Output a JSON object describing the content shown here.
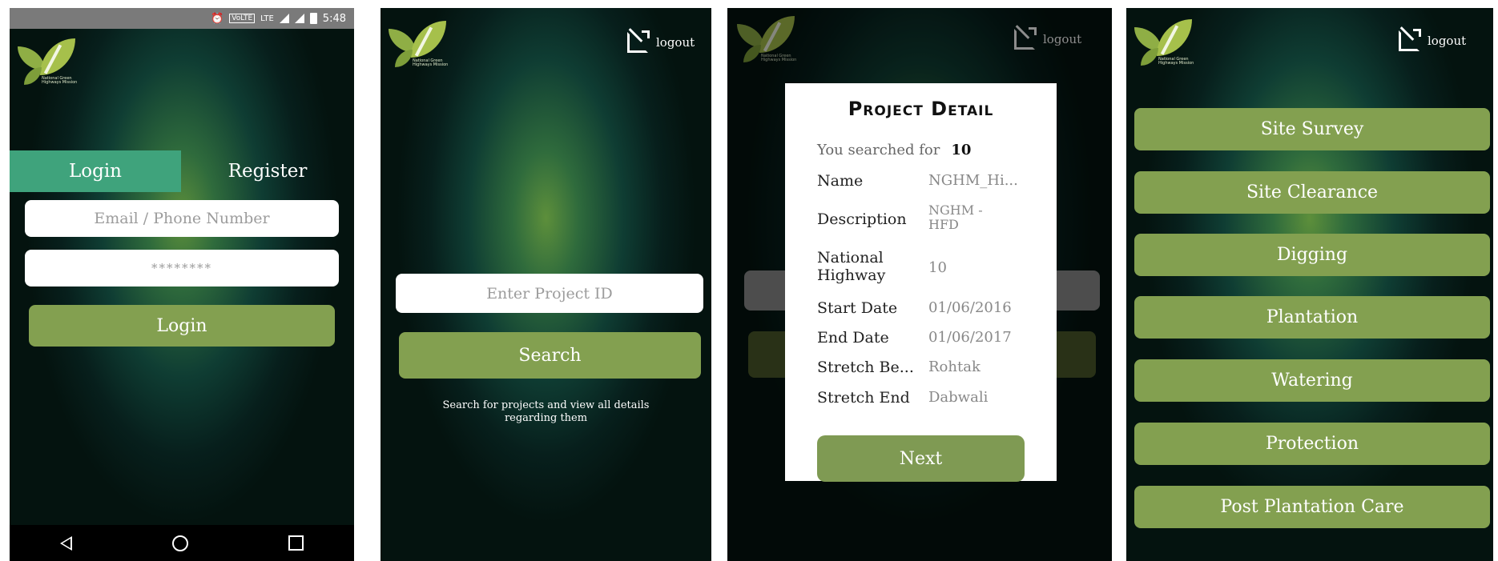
{
  "status_bar": {
    "icons": [
      "alarm-icon",
      "volte-icon",
      "lte-icon",
      "signal-icon",
      "signal-icon",
      "battery-icon"
    ],
    "volte": "VoLTE",
    "lte": "LTE",
    "time": "5:48"
  },
  "logo": {
    "tagline": "National Green Highways Mission"
  },
  "logout_label": "logout",
  "login_screen": {
    "tab_login": "Login",
    "tab_register": "Register",
    "email_placeholder": "Email / Phone Number",
    "password_value": "********",
    "login_button": "Login"
  },
  "search_screen": {
    "project_id_placeholder": "Enter Project ID",
    "search_button": "Search",
    "hint": "Search for projects and view all details regarding them"
  },
  "project_detail": {
    "title": "Project Detail",
    "searched_label": "You searched for",
    "searched_value": "10",
    "rows": [
      {
        "label": "Name",
        "value": "NGHM_Hi..."
      },
      {
        "label": "Description",
        "value": "NGHM - HFD"
      },
      {
        "label": "National Highway",
        "value": "10"
      },
      {
        "label": "Start Date",
        "value": "01/06/2016"
      },
      {
        "label": "End Date",
        "value": "01/06/2017"
      },
      {
        "label": "Stretch Be...",
        "value": "Rohtak"
      },
      {
        "label": "Stretch End",
        "value": "Dabwali"
      }
    ],
    "next_button": "Next"
  },
  "menu_screen": {
    "items": [
      "Site Survey",
      "Site Clearance",
      "Digging",
      "Plantation",
      "Watering",
      "Protection",
      "Post Plantation Care"
    ]
  },
  "colors": {
    "button_green": "#83a050",
    "tab_active": "#3fa37c"
  }
}
